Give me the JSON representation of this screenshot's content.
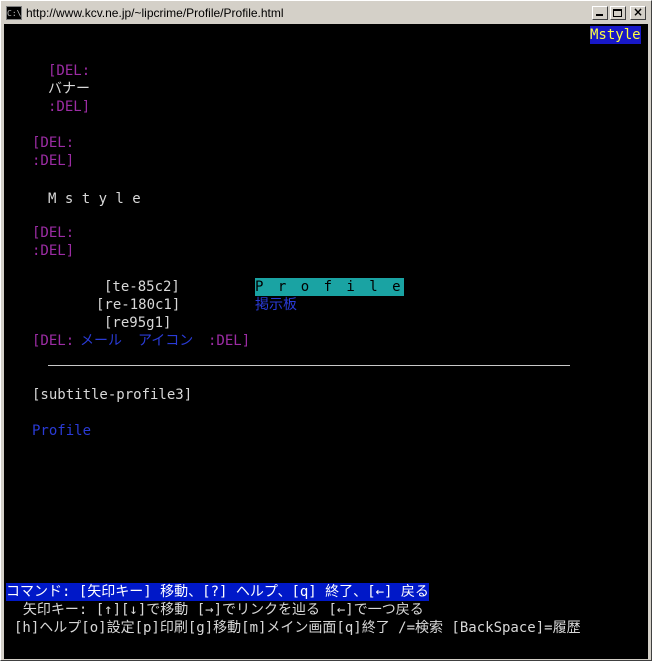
{
  "window": {
    "title": "http://www.kcv.ne.jp/~lipcrime/Profile/Profile.html",
    "icon_label": "C:\\"
  },
  "page": {
    "mstyle_link": "Mstyle",
    "banner_del_open": "[DEL:",
    "banner_text": "バナー",
    "banner_del_close": ":DEL]",
    "del1_open": "[DEL:",
    "del1_close": ":DEL]",
    "site_title": "M s t y l e",
    "del2_open": "[DEL:",
    "del2_close": ":DEL]",
    "img1": "[te-85c2]",
    "img2": "[re-180c1]",
    "img3": "[re95g1]",
    "nav_profile": "P r o f i l e",
    "nav_bbs": "掲示板",
    "mail_del_open": "[DEL:",
    "mail_link": "メール",
    "icon_link": "アイコン",
    "mail_del_close": ":DEL]",
    "subtitle": "[subtitle-profile3]",
    "profile_link": "Profile"
  },
  "statusbar": {
    "line1": "コマンド: [矢印キー] 移動、[?] ヘルプ、[q] 終了、[←] 戻る",
    "line2": "  矢印キー: [↑][↓]で移動 [→]でリンクを辿る [←]で一つ戻る",
    "line3": "[h]ヘルプ[o]設定[p]印刷[g]移動[m]メイン画面[q]終了 /=検索 [BackSpace]=履歴"
  },
  "colors": {
    "background": "#000000",
    "del_text": "#9c2ca4",
    "link": "#2a3bd6",
    "selected_link_bg": "#1aa3a3",
    "statusbar_bg": "#0018c8"
  }
}
